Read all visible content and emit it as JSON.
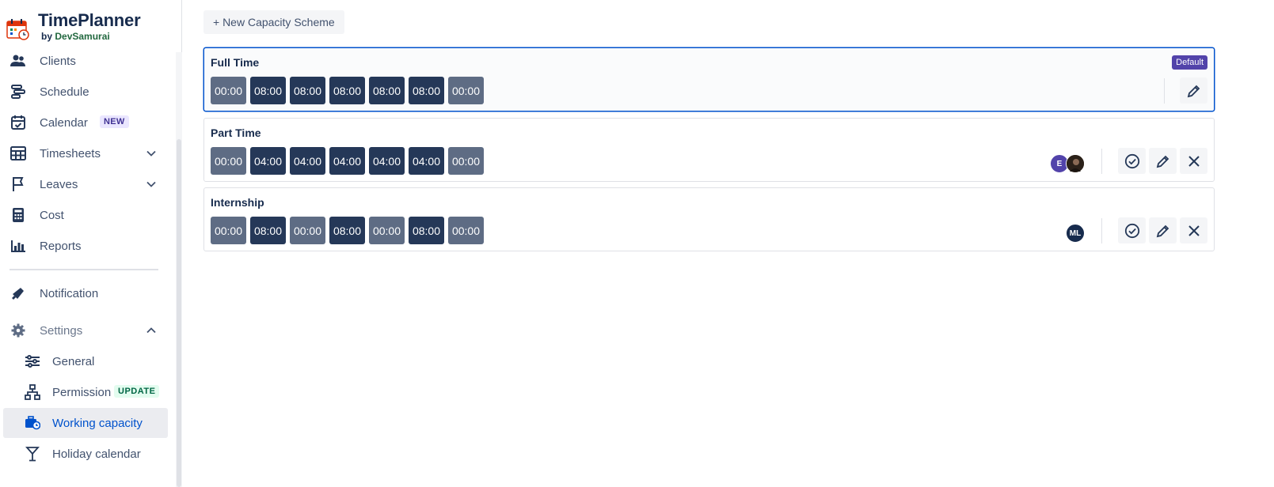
{
  "brand": {
    "title": "TimePlanner",
    "by": "by",
    "company": "DevSamurai"
  },
  "sidebar": {
    "items": [
      {
        "label": "Clients"
      },
      {
        "label": "Schedule"
      },
      {
        "label": "Calendar",
        "badge": "NEW"
      },
      {
        "label": "Timesheets"
      },
      {
        "label": "Leaves"
      },
      {
        "label": "Cost"
      },
      {
        "label": "Reports"
      },
      {
        "label": "Notification"
      },
      {
        "label": "Settings"
      }
    ],
    "settings_items": [
      {
        "label": "General"
      },
      {
        "label": "Permission",
        "badge": "UPDATE"
      },
      {
        "label": "Working capacity"
      },
      {
        "label": "Holiday calendar"
      }
    ]
  },
  "main": {
    "new_button": "+ New Capacity Scheme",
    "schemes": [
      {
        "name": "Full Time",
        "badge": "Default",
        "days": [
          "00:00",
          "08:00",
          "08:00",
          "08:00",
          "08:00",
          "08:00",
          "00:00"
        ]
      },
      {
        "name": "Part Time",
        "days": [
          "00:00",
          "04:00",
          "04:00",
          "04:00",
          "04:00",
          "04:00",
          "00:00"
        ],
        "avatars": [
          "E",
          ""
        ]
      },
      {
        "name": "Internship",
        "days": [
          "00:00",
          "08:00",
          "00:00",
          "08:00",
          "00:00",
          "08:00",
          "00:00"
        ],
        "avatars": [
          "ML"
        ]
      }
    ]
  },
  "colors": {
    "accent": "#0052cc",
    "day_on": "#253858",
    "day_off": "#5e6c84",
    "default_badge": "#5243aa"
  }
}
